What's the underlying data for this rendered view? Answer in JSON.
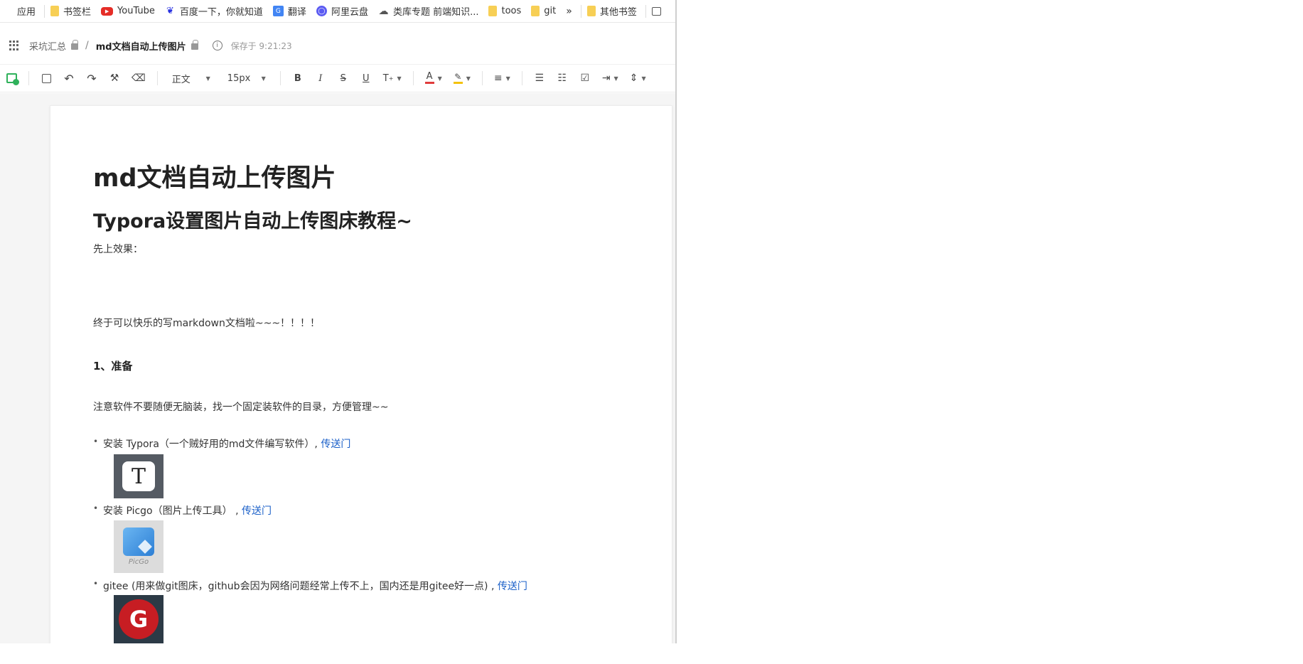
{
  "bookmarks": [
    {
      "label": "应用",
      "icon": "apps-grid-icon"
    },
    {
      "label": "书签栏",
      "icon": "folder-icon"
    },
    {
      "label": "YouTube",
      "icon": "youtube-icon"
    },
    {
      "label": "百度一下，你就知道",
      "icon": "baidu-paw-icon"
    },
    {
      "label": "翻译",
      "icon": "google-translate-icon"
    },
    {
      "label": "阿里云盘",
      "icon": "aliyun-drive-icon"
    },
    {
      "label": "类库专题 前端知识...",
      "icon": "cloud-sketch-icon"
    },
    {
      "label": "toos",
      "icon": "folder-icon"
    },
    {
      "label": "git",
      "icon": "folder-icon"
    },
    {
      "label": "»",
      "icon": "more-bookmarks-icon"
    },
    {
      "label": "其他书签",
      "icon": "folder-icon"
    }
  ],
  "header": {
    "workspace": "采坑汇总",
    "separator": "/",
    "doc_title": "md文档自动上传图片",
    "saved_status": "保存于 9:21:23"
  },
  "toolbar": {
    "style_select": "正文",
    "font_size_select": "15px",
    "bold": "B",
    "italic": "I",
    "strike": "S",
    "underline": "U",
    "superscript": "T",
    "font_color": "A",
    "colors": {
      "font_color": "#e03c3c",
      "highlight": "#f4c20d",
      "link": "#1a5fc8",
      "insert_green": "#2fb15b"
    }
  },
  "document": {
    "h1": "md文档自动上传图片",
    "h2": "Typora设置图片自动上传图床教程~",
    "intro": "先上效果：",
    "happy": "终于可以快乐的写markdown文档啦~~~！！！！",
    "section1": "1、准备",
    "note": "注意软件不要随便无脑装，找一个固定装软件的目录，方便管理~~",
    "items": [
      {
        "text": "安装 Typora（一个贼好用的md文件编写软件）, ",
        "link": "传送门",
        "image": "typora-logo-icon"
      },
      {
        "text": "安装 Picgo（图片上传工具） , ",
        "link": "传送门",
        "image": "picgo-logo-icon",
        "image_caption": "PicGo"
      },
      {
        "text": "gitee (用来做git图床，github会因为网络问题经常上传不上，国内还是用gitee好一点) , ",
        "link": "传送门",
        "image": "gitee-logo-icon"
      }
    ]
  }
}
